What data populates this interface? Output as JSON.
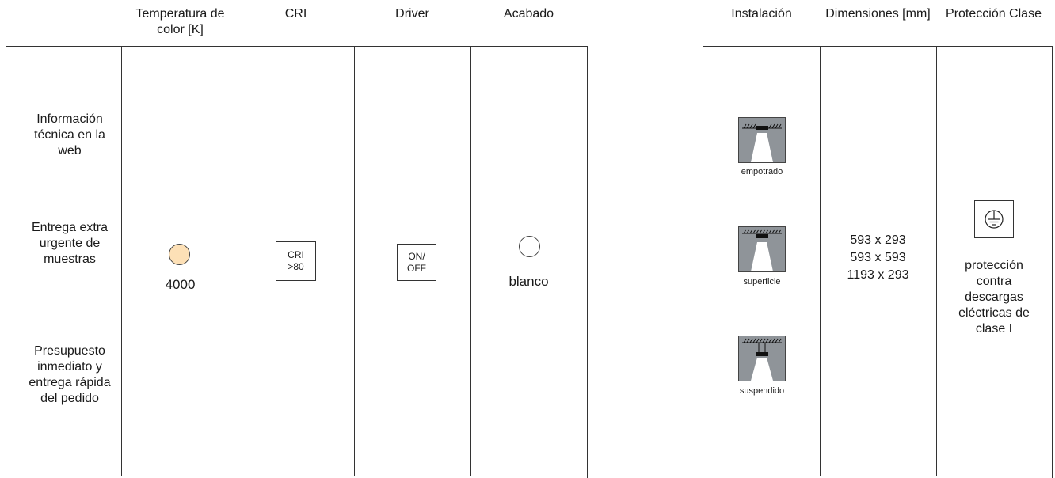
{
  "headers": {
    "temperatura": "Temperatura de color [K]",
    "cri": "CRI",
    "driver": "Driver",
    "acabado": "Acabado",
    "instalacion": "Instalación",
    "dimensiones": "Dimensiones [mm]",
    "proteccion": "Protección Clase"
  },
  "side_notes": [
    "Información técnica en la web",
    "Entrega extra urgente de muestras",
    "Presupuesto inmediato y entrega rápida del pedido"
  ],
  "temperatura": {
    "value": "4000",
    "swatch_color": "#fde0b6"
  },
  "cri": {
    "badge_line1": "CRI",
    "badge_line2": ">80"
  },
  "driver": {
    "badge_line1": "ON/",
    "badge_line2": "OFF"
  },
  "acabado": {
    "value": "blanco",
    "swatch_color": "#ffffff"
  },
  "instalacion": [
    {
      "label": "empotrado",
      "icon": "recessed-install-icon"
    },
    {
      "label": "superficie",
      "icon": "surface-install-icon"
    },
    {
      "label": "suspendido",
      "icon": "suspended-install-icon"
    }
  ],
  "dimensiones": [
    "593 x 293",
    "593 x 593",
    "1193 x 293"
  ],
  "proteccion": {
    "icon": "earth-ground-icon",
    "text": "protección contra descargas eléctricas de clase I"
  }
}
